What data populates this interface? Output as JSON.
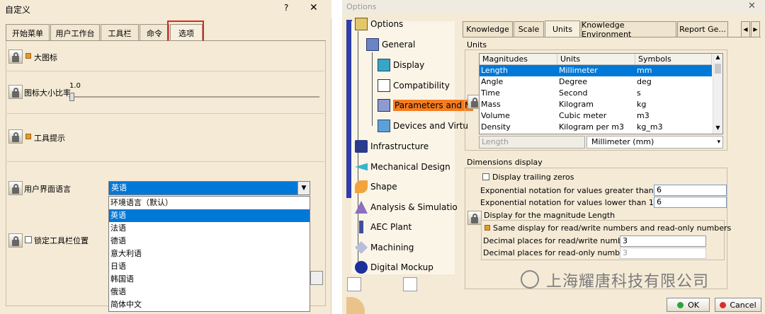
{
  "left_dialog": {
    "title": "自定义",
    "help_label": "?",
    "close_label": "✕",
    "tabs": [
      "开始菜单",
      "用户工作台",
      "工具栏",
      "命令",
      "选项"
    ],
    "large_icons_label": "大图标",
    "icon_ratio_label": "图标大小比率",
    "icon_ratio_value": "1.0",
    "tooltips_label": "工具提示",
    "ui_language_label": "用户界面语言",
    "language_selected": "英语",
    "language_options": [
      "环境语言（默认）",
      "英语",
      "法语",
      "德语",
      "意大利语",
      "日语",
      "韩国语",
      "俄语",
      "简体中文"
    ],
    "lock_toolbar_label": "锁定工具栏位置"
  },
  "right_dialog": {
    "title": "Options",
    "close_label": "✕",
    "tree": [
      "Options",
      "General",
      "Display",
      "Compatibility",
      "Parameters and M",
      "Devices and Virtu",
      "Infrastructure",
      "Mechanical Design",
      "Shape",
      "Analysis & Simulatio",
      "AEC Plant",
      "Machining",
      "Digital Mockup"
    ],
    "tabs": [
      "Knowledge",
      "Scale",
      "Units",
      "Knowledge Environment",
      "Report Ge..."
    ],
    "scroll_arrows": [
      "◀",
      "▶"
    ],
    "units_group": "Units",
    "table_headers": [
      "Magnitudes",
      "Units",
      "Symbols"
    ],
    "table_rows": [
      [
        "Length",
        "Millimeter",
        "mm"
      ],
      [
        "Angle",
        "Degree",
        "deg"
      ],
      [
        "Time",
        "Second",
        "s"
      ],
      [
        "Mass",
        "Kilogram",
        "kg"
      ],
      [
        "Volume",
        "Cubic meter",
        "m3"
      ],
      [
        "Density",
        "Kilogram per m3",
        "kg_m3"
      ]
    ],
    "selected_magnitude": "Length",
    "selected_unit": "Millimeter (mm)",
    "dimensions_group": "Dimensions display",
    "trailing_zeros_label": "Display trailing zeros",
    "exp_greater_label": "Exponential notation for values greater than 10e+",
    "exp_greater_value": "6",
    "exp_lower_label": "Exponential notation for values lower than 10e-",
    "exp_lower_value": "6",
    "magnitude_group": "Display for the magnitude Length",
    "same_display_label": "Same display for read/write numbers and read-only numbers",
    "dec_rw_label": "Decimal places for read/write numbers",
    "dec_rw_value": "3",
    "dec_ro_label": "Decimal places for read-only numbers",
    "dec_ro_value": "3",
    "ok_label": "OK",
    "cancel_label": "Cancel",
    "watermark": "上海耀唐科技有限公司"
  }
}
